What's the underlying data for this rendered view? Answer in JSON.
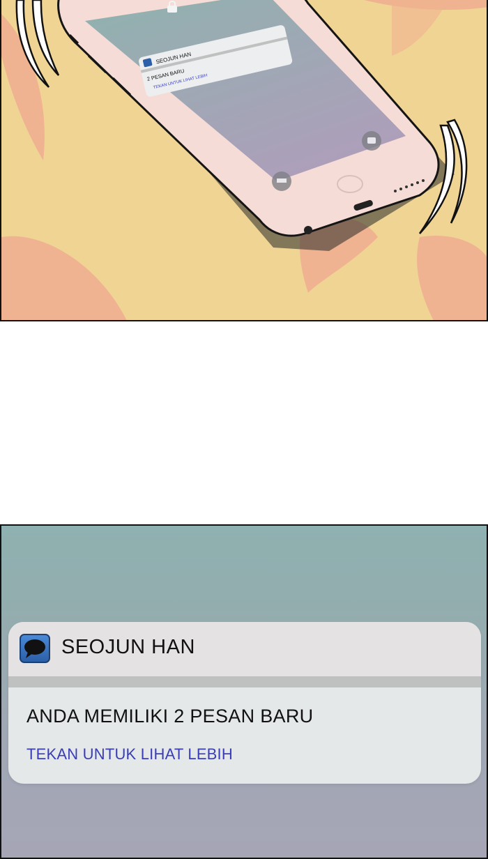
{
  "top_panel": {
    "phone_lock_notification": {
      "sender": "SEOJUN HAN",
      "message": "2 PESAN BARU",
      "action": "TEKAN UNTUK LIHAT LEBIH"
    }
  },
  "bottom_panel": {
    "notification": {
      "sender": "SEOJUN HAN",
      "message": "ANDA MEMILIKI 2 PESAN BARU",
      "action": "TEKAN UNTUK LIHAT LEBIH"
    }
  },
  "colors": {
    "background_yellow": "#f0d494",
    "petal": "#f0a890",
    "phone_body": "#f5dcd6",
    "link_blue": "#3a3db8"
  }
}
